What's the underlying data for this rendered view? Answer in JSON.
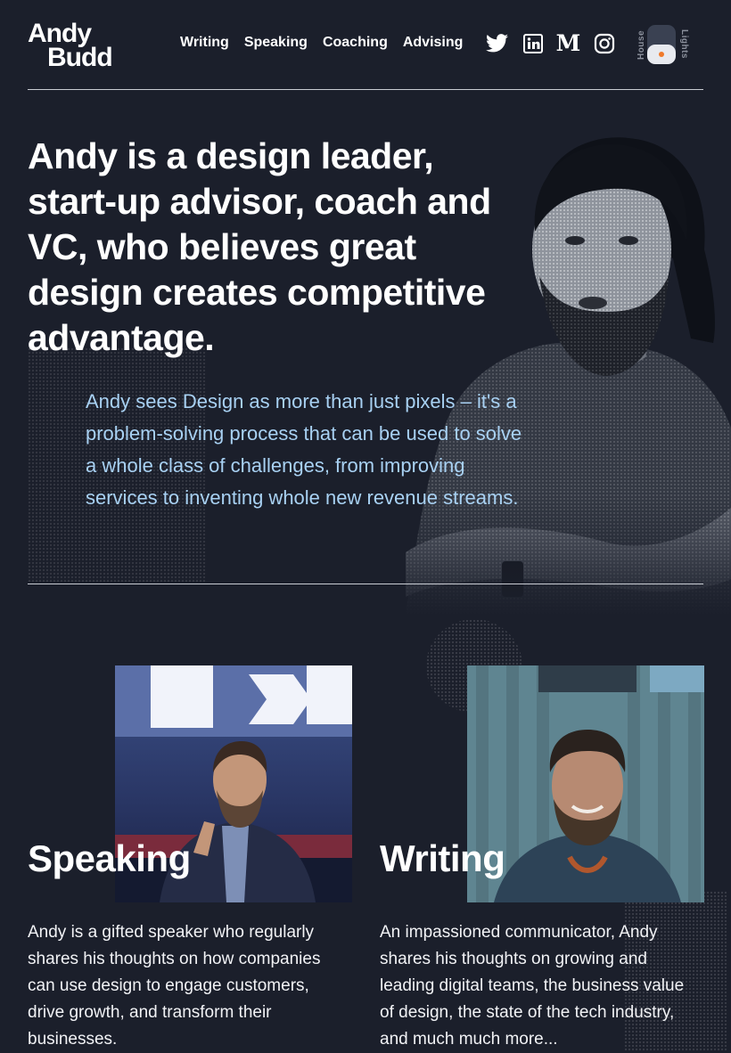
{
  "logo": {
    "line1": "Andy",
    "line2": "Budd"
  },
  "nav": {
    "items": [
      {
        "label": "Writing"
      },
      {
        "label": "Speaking"
      },
      {
        "label": "Coaching"
      },
      {
        "label": "Advising"
      }
    ]
  },
  "social": {
    "icons": [
      "twitter-icon",
      "linkedin-icon",
      "medium-icon",
      "instagram-icon"
    ]
  },
  "theme_toggle": {
    "left_label": "House",
    "right_label": "Lights"
  },
  "hero": {
    "title": "Andy is a design leader, start-up advisor, coach and VC, who believes great design creates competitive advantage.",
    "intro": "Andy sees Design as more than just pixels – it's a problem-solving process that can be used to solve a whole class of challenges, from improving services to inventing whole new revenue streams."
  },
  "cards": [
    {
      "title": "Speaking",
      "text": "Andy is a gifted speaker who regularly shares his thoughts on how companies can use design to engage customers, drive growth, and transform their businesses."
    },
    {
      "title": "Writing",
      "text": "An impassioned communicator, Andy shares his thoughts on growing and leading digital teams, the business value of design, the state of the tech industry, and much much more..."
    }
  ],
  "colors": {
    "background": "#1b1f2b",
    "accent_blue": "#a8d1f3",
    "toggle_dot": "#f07a2a"
  }
}
